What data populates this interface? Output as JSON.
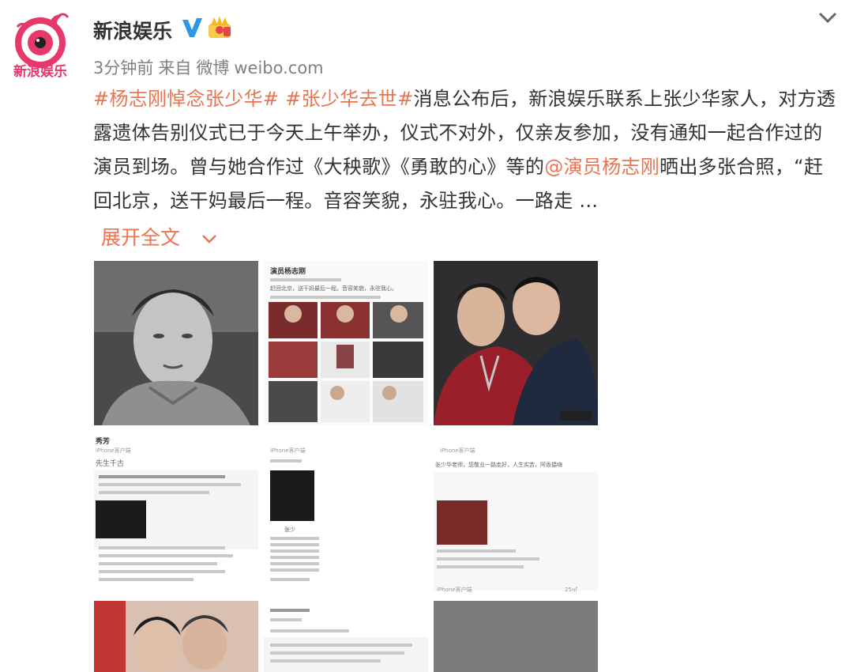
{
  "header": {
    "avatar_text": "新浪娱乐",
    "username": "新浪娱乐",
    "verified_icon": "verified-v-icon",
    "member_icon": "crown-badge-icon",
    "menu_icon": "chevron-down-icon"
  },
  "meta": {
    "time": "3分钟前",
    "source_prefix": "来自",
    "source": "微博",
    "source_site": "weibo.com"
  },
  "post": {
    "tag1": "#杨志刚悼念张少华#",
    "tag2": "#张少华去世#",
    "text1": "消息公布后，新浪娱乐联系上张少华家人，对方透露遗体告别仪式已于今天上午举办，仪式不对外，仅亲友参加，没有通知一起合作过的演员到场。曾与她合作过《大秧歌》《勇敢的心》等的",
    "mention": "@演员杨志刚",
    "text2": "晒出多张合照，“赶回北京，送干妈最后一程。音容笑貌，永驻我心。一路走 ...",
    "expand_label": "展开全文"
  },
  "images": {
    "tile2_lines": [
      "演员杨志刚",
      "赶回北京，送干妈最后一程。音容笑貌，永驻我心。"
    ],
    "tile4_lines": [
      "秀芳",
      "iPhone客户端",
      "先生千古"
    ],
    "tile5_lines": [
      "iPhone客户端",
      "张少"
    ],
    "tile6_lines": [
      "iPhone客户端",
      "张少华老师，您敬业一路走好，人生实苦，阿香揾嗨",
      "iPhone客户端",
      "25㎡"
    ]
  },
  "colors": {
    "link": "#eb7350",
    "brand_pink": "#e6386a",
    "verified": "#2e96e6",
    "meta": "#808080"
  }
}
